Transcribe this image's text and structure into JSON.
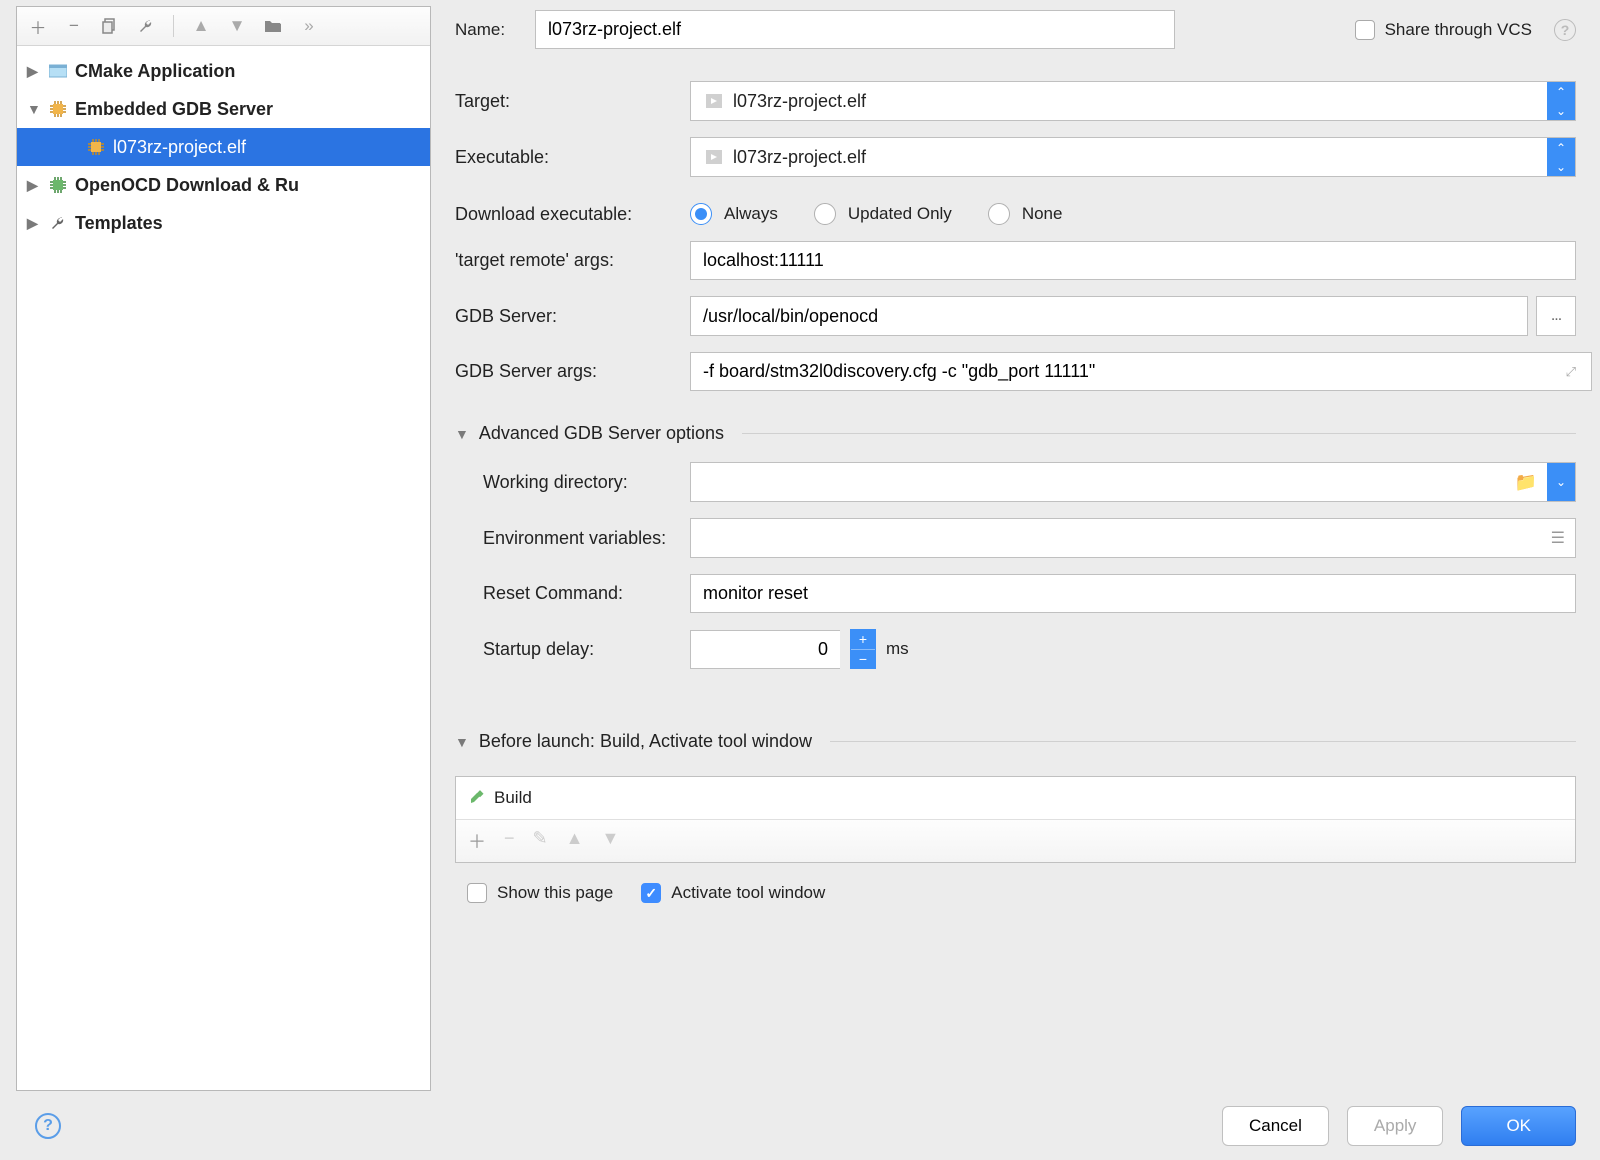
{
  "sidebar": {
    "items": [
      {
        "label": "CMake Application",
        "expanded": false,
        "selected": false,
        "type": "cmake"
      },
      {
        "label": "Embedded GDB Server",
        "expanded": true,
        "selected": false,
        "type": "chip",
        "children": [
          {
            "label": "l073rz-project.elf",
            "selected": true,
            "type": "chip"
          }
        ]
      },
      {
        "label": "OpenOCD Download & Ru",
        "expanded": false,
        "selected": false,
        "type": "chip-green"
      },
      {
        "label": "Templates",
        "expanded": false,
        "selected": false,
        "type": "wrench"
      }
    ]
  },
  "top": {
    "name_label": "Name:",
    "name_value": "l073rz-project.elf",
    "share_label": "Share through VCS"
  },
  "form": {
    "target_label": "Target:",
    "target_value": "l073rz-project.elf",
    "executable_label": "Executable:",
    "executable_value": "l073rz-project.elf",
    "download_label": "Download executable:",
    "download_opts": {
      "always": "Always",
      "updated": "Updated Only",
      "none": "None"
    },
    "download_selected": "always",
    "remote_args_label": "'target remote' args:",
    "remote_args_value": "localhost:11111",
    "gdb_server_label": "GDB Server:",
    "gdb_server_value": "/usr/local/bin/openocd",
    "gdb_args_label": "GDB Server args:",
    "gdb_args_value": "-f board/stm32l0discovery.cfg -c \"gdb_port 11111\""
  },
  "advanced": {
    "title": "Advanced GDB Server options",
    "working_dir_label": "Working directory:",
    "working_dir_value": "",
    "env_label": "Environment variables:",
    "env_value": "",
    "reset_label": "Reset Command:",
    "reset_value": "monitor reset",
    "delay_label": "Startup delay:",
    "delay_value": "0",
    "delay_unit": "ms"
  },
  "before": {
    "title": "Before launch: Build, Activate tool window",
    "item": "Build",
    "show_page": "Show this page",
    "activate": "Activate tool window"
  },
  "footer": {
    "cancel": "Cancel",
    "apply": "Apply",
    "ok": "OK"
  }
}
